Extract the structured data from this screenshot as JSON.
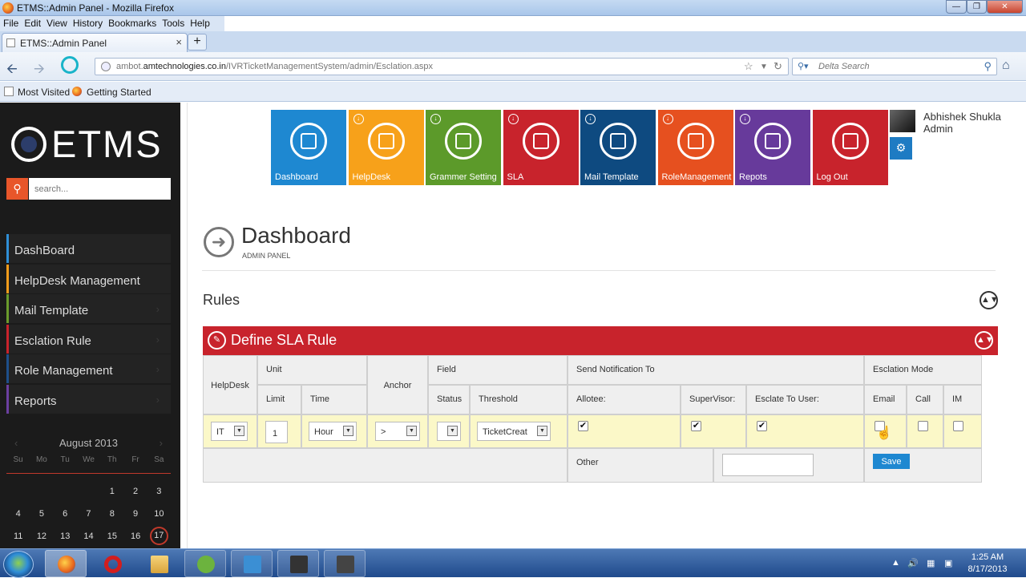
{
  "browser": {
    "window_title": "ETMS::Admin Panel - Mozilla Firefox",
    "menu": [
      "File",
      "Edit",
      "View",
      "History",
      "Bookmarks",
      "Tools",
      "Help"
    ],
    "tab_title": "ETMS::Admin Panel",
    "url_prefix": "ambot.",
    "url_domain": "amtechnologies.co.in",
    "url_path": "/IVRTicketManagementSystem/admin/Esclation.aspx",
    "search_placeholder": "Delta Search",
    "bookmarks": [
      "Most Visited",
      "Getting Started"
    ]
  },
  "sidebar": {
    "logo_text": "ETMS",
    "search_placeholder": "search...",
    "items": [
      {
        "label": "DashBoard",
        "color": "#2f8fd6"
      },
      {
        "label": "HelpDesk Management",
        "color": "#f59c1a"
      },
      {
        "label": "Mail Template",
        "color": "#6a9b2c"
      },
      {
        "label": "Esclation Rule",
        "color": "#c8232c"
      },
      {
        "label": "Role Management",
        "color": "#1e4f8a"
      },
      {
        "label": "Reports",
        "color": "#6b3fa0"
      }
    ],
    "calendar": {
      "month": "August 2013",
      "dow": [
        "Su",
        "Mo",
        "Tu",
        "We",
        "Th",
        "Fr",
        "Sa"
      ],
      "weeks": [
        [
          "",
          "",
          "",
          "",
          "1",
          "2",
          "3"
        ],
        [
          "4",
          "5",
          "6",
          "7",
          "8",
          "9",
          "10"
        ],
        [
          "11",
          "12",
          "13",
          "14",
          "15",
          "16",
          "17"
        ]
      ],
      "today": "17"
    }
  },
  "tiles": [
    {
      "label": "Dashboard",
      "color": "#1e88d1",
      "arrow": false
    },
    {
      "label": "HelpDesk",
      "color": "#f7a11a",
      "arrow": true
    },
    {
      "label": "Grammer Setting",
      "color": "#5c9a2a",
      "arrow": true
    },
    {
      "label": "SLA",
      "color": "#c8232c",
      "arrow": true
    },
    {
      "label": "Mail Template",
      "color": "#0e4a80",
      "arrow": true
    },
    {
      "label": "RoleManagement",
      "color": "#e6501f",
      "arrow": true
    },
    {
      "label": "Repots",
      "color": "#673a9b",
      "arrow": true
    },
    {
      "label": "Log Out",
      "color": "#c8232c",
      "arrow": false
    }
  ],
  "user": {
    "name": "Abhishek Shukla",
    "role": "Admin"
  },
  "page": {
    "title": "Dashboard",
    "subtitle": "ADMIN PANEL",
    "section": "Rules",
    "panel_title": "Define SLA Rule"
  },
  "grid": {
    "headers": {
      "helpdesk": "HelpDesk",
      "unit": "Unit",
      "limit": "Limit",
      "time": "Time",
      "anchor": "Anchor",
      "field": "Field",
      "status": "Status",
      "threshold": "Threshold",
      "notify": "Send Notification To",
      "allotee": "Allotee:",
      "supervisor": "SuperVisor:",
      "esclate_user": "Esclate To User:",
      "mode": "Esclation Mode",
      "email": "Email",
      "call": "Call",
      "im": "IM",
      "other": "Other"
    },
    "row": {
      "helpdesk": "IT",
      "limit": "1",
      "time": "Hour",
      "anchor": ">",
      "status": "",
      "threshold": "TicketCreat",
      "allotee": true,
      "supervisor": true,
      "esclate_user": true,
      "email": false,
      "call": false,
      "im": false,
      "other": ""
    },
    "save_label": "Save"
  },
  "taskbar": {
    "time": "1:25 AM",
    "date": "8/17/2013"
  }
}
